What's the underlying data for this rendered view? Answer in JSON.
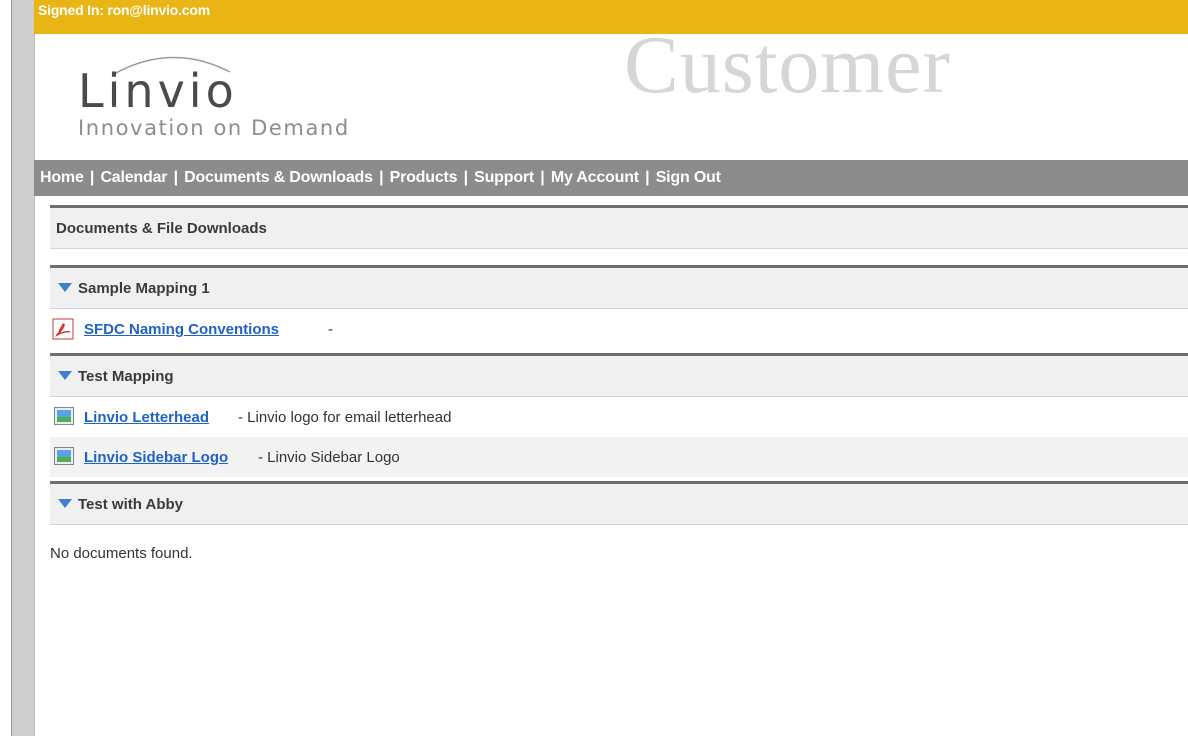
{
  "header": {
    "signed_in": "Signed In: ron@linvio.com",
    "watermark": "Customer"
  },
  "logo": {
    "name": "Linvio",
    "tagline": "Innovation on Demand"
  },
  "nav": {
    "items": [
      "Home",
      "Calendar",
      "Documents & Downloads",
      "Products",
      "Support",
      "My Account",
      "Sign Out"
    ],
    "separator": "|"
  },
  "main": {
    "section_title": "Documents & File Downloads",
    "groups": [
      {
        "title": "Sample Mapping 1",
        "documents": [
          {
            "icon": "pdf-icon",
            "link": "SFDC Naming Conventions",
            "description": " -"
          }
        ]
      },
      {
        "title": "Test Mapping",
        "documents": [
          {
            "icon": "image-file-icon",
            "link": "Linvio Letterhead",
            "description": " - Linvio logo for email letterhead"
          },
          {
            "icon": "image-file-icon",
            "link": "Linvio Sidebar Logo",
            "description": " - Linvio Sidebar Logo"
          }
        ]
      },
      {
        "title": "Test with Abby",
        "documents": [],
        "empty_message": "No documents found."
      }
    ]
  },
  "colors": {
    "signin_bar": "#e8b514",
    "nav_bar": "#8c8c8c",
    "link": "#1f63c5",
    "accent_triangle": "#3e7fd6"
  }
}
